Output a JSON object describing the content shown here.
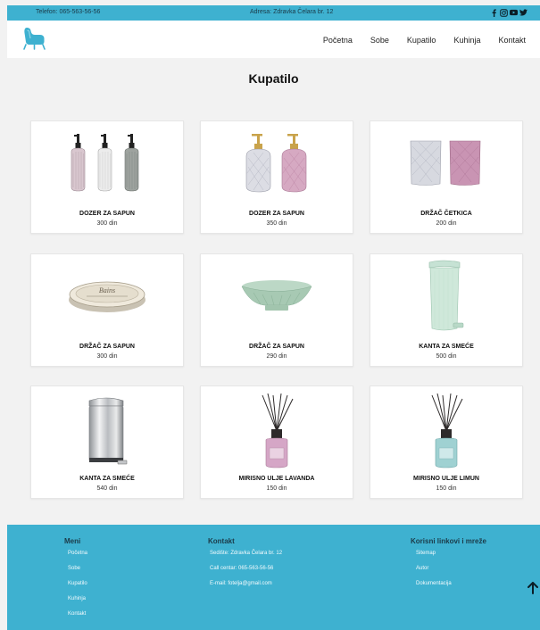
{
  "topbar": {
    "phone": "Telefon: 065-563-56-56",
    "address": "Adresa: Zdravka Čelara br. 12",
    "social_icons": [
      "facebook-icon",
      "instagram-icon",
      "youtube-icon",
      "twitter-icon"
    ]
  },
  "nav": {
    "items": [
      "Početna",
      "Sobe",
      "Kupatilo",
      "Kuhinja",
      "Kontakt"
    ]
  },
  "page": {
    "title": "Kupatilo"
  },
  "products": [
    {
      "name": "DOZER ZA SAPUN",
      "price": "300 din"
    },
    {
      "name": "DOZER ZA SAPUN",
      "price": "350 din"
    },
    {
      "name": "DRŽAČ ČETKICA",
      "price": "200 din"
    },
    {
      "name": "DRŽAČ ZA SAPUN",
      "price": "300 din"
    },
    {
      "name": "DRŽAČ ZA SAPUN",
      "price": "290 din"
    },
    {
      "name": "KANTA ZA SMEĆE",
      "price": "500 din"
    },
    {
      "name": "KANTA ZA SMEĆE",
      "price": "540 din"
    },
    {
      "name": "MIRISNO ULJE LAVANDA",
      "price": "150 din"
    },
    {
      "name": "MIRISNO ULJE LIMUN",
      "price": "150 din"
    }
  ],
  "footer": {
    "menu": {
      "heading": "Meni",
      "items": [
        "Početna",
        "Sobe",
        "Kupatilo",
        "Kuhinja",
        "Kontakt"
      ]
    },
    "contact": {
      "heading": "Kontakt",
      "items": [
        "Sedište: Zdravka Čelara br. 12",
        "Call centar: 065-563-56-56",
        "E-mail: fotelja@gmail.com"
      ]
    },
    "links": {
      "heading": "Korisni linkovi i mreže",
      "items": [
        "Sitemap",
        "Autor",
        "Dokumentacija"
      ]
    }
  },
  "colors": {
    "accent": "#3eb1d0",
    "background": "#f2f2f2",
    "card": "#ffffff",
    "dark_text": "#1b3a48"
  }
}
